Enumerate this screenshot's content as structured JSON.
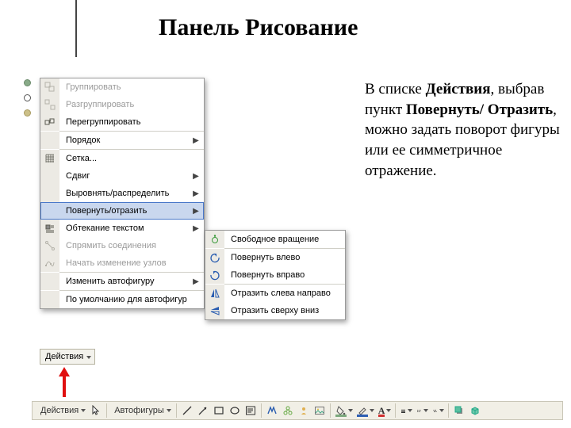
{
  "title": "Панель Рисование",
  "menu": {
    "items": [
      {
        "label": "Группировать",
        "disabled": true,
        "arrow": false,
        "icon": "group"
      },
      {
        "label": "Разгруппировать",
        "disabled": true,
        "arrow": false,
        "icon": "ungroup"
      },
      {
        "label": "Перегруппировать",
        "disabled": false,
        "arrow": false,
        "icon": "regroup"
      },
      {
        "sep": true
      },
      {
        "label": "Порядок",
        "disabled": false,
        "arrow": true,
        "icon": ""
      },
      {
        "sep": true
      },
      {
        "label": "Сетка...",
        "disabled": false,
        "arrow": false,
        "icon": "grid"
      },
      {
        "label": "Сдвиг",
        "disabled": false,
        "arrow": true,
        "icon": ""
      },
      {
        "label": "Выровнять/распределить",
        "disabled": false,
        "arrow": true,
        "icon": ""
      },
      {
        "label": "Повернуть/отразить",
        "disabled": false,
        "arrow": true,
        "icon": "",
        "hl": true
      },
      {
        "label": "Обтекание текстом",
        "disabled": false,
        "arrow": true,
        "icon": "wrap"
      },
      {
        "label": "Спрямить соединения",
        "disabled": true,
        "arrow": false,
        "icon": "conn"
      },
      {
        "label": "Начать изменение узлов",
        "disabled": true,
        "arrow": false,
        "icon": "nodes"
      },
      {
        "sep": true
      },
      {
        "label": "Изменить автофигуру",
        "disabled": false,
        "arrow": true,
        "icon": ""
      },
      {
        "sep": true
      },
      {
        "label": "По умолчанию для автофигур",
        "disabled": false,
        "arrow": false,
        "icon": ""
      }
    ]
  },
  "submenu": {
    "items": [
      {
        "label": "Свободное вращение",
        "icon": "free-rotate"
      },
      {
        "sep": true
      },
      {
        "label": "Повернуть влево",
        "icon": "rotate-left"
      },
      {
        "label": "Повернуть вправо",
        "icon": "rotate-right"
      },
      {
        "sep": true
      },
      {
        "label": "Отразить слева направо",
        "icon": "flip-h"
      },
      {
        "label": "Отразить сверху вниз",
        "icon": "flip-v"
      }
    ]
  },
  "actions_button": "Действия",
  "body": {
    "t1": "В списке ",
    "b1": "Действия",
    "t2": ", выбрав пункт ",
    "b2": "Повернуть/ Отразить",
    "t3": ", можно задать поворот фигуры или ее симметричное отражение."
  },
  "toolbar": {
    "actions": "Действия",
    "autoshapes": "Автофигуры"
  }
}
